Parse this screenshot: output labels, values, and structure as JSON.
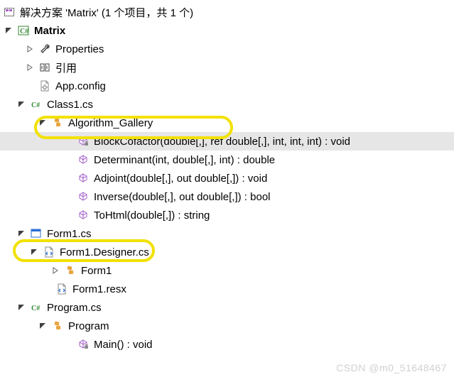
{
  "solution": {
    "label": "解决方案 'Matrix' (1 个项目，共 1 个)"
  },
  "project": {
    "name": "Matrix"
  },
  "nodes": {
    "properties": "Properties",
    "references": "引用",
    "appconfig": "App.config",
    "class1": "Class1.cs",
    "alg_gallery": "Algorithm_Gallery",
    "methods": {
      "blockcofactor": "BlockCofactor(double[,], ref double[,], int, int, int) : void",
      "determinant": "Determinant(int, double[,], int) : double",
      "adjoint": "Adjoint(double[,], out double[,]) : void",
      "inverse": "Inverse(double[,], out double[,]) : bool",
      "tohtml": "ToHtml(double[,]) : string"
    },
    "form1": "Form1.cs",
    "form1designer": "Form1.Designer.cs",
    "form1class": "Form1",
    "form1resx": "Form1.resx",
    "program": "Program.cs",
    "programclass": "Program",
    "main": "Main() : void"
  },
  "watermark": "CSDN @m0_51648467"
}
